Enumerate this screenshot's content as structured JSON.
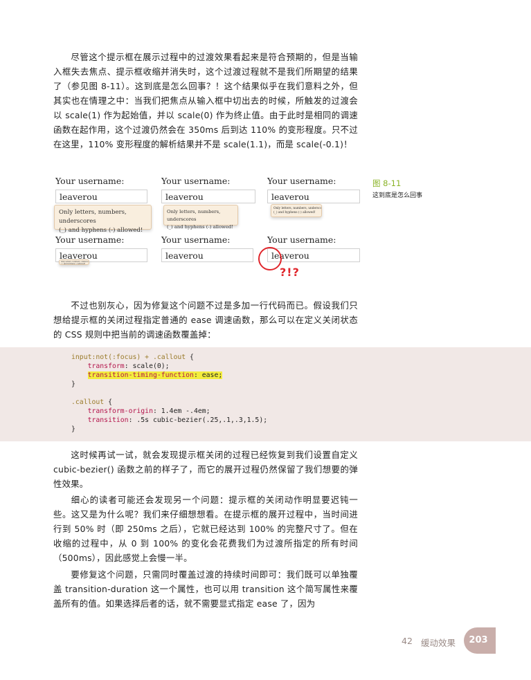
{
  "paragraphs": {
    "p1": "尽管这个提示框在展示过程中的过渡效果看起来是符合预期的，但是当输入框失去焦点、提示框收缩并消失时，这个过渡过程就不是我们所期望的结果了（参见图 8-11）。这到底是怎么回事？！这个结果似乎在我们意料之外，但其实也在情理之中：当我们把焦点从输入框中切出去的时候，所触发的过渡会以 scale(1) 作为起始值，并以 scale(0) 作为终止值。由于此时是相同的调速函数在起作用，这个过渡仍然会在 350ms 后到达 110% 的变形程度。只不过在这里，110% 变形程度的解析结果并不是 scale(1.1)，而是 scale(-0.1)！",
    "p2": "不过也别灰心，因为修复这个问题不过是多加一行代码而已。假设我们只想给提示框的关闭过程指定普通的 ease 调速函数，那么可以在定义关闭状态的 CSS 规则中把当前的调速函数覆盖掉：",
    "p3": "这时候再试一试，就会发现提示框关闭的过程已经恢复到我们设置自定义 cubic-bezier() 函数之前的样子了，而它的展开过程仍然保留了我们想要的弹性效果。",
    "p4": "细心的读者可能还会发现另一个问题：提示框的关闭动作明显要迟钝一些。这又是为什么呢？我们来仔细想想看。在提示框的展开过程中，当时间进行到 50% 时（即 250ms 之后），它就已经达到 100% 的完整尺寸了。但在收缩的过程中，从 0 到 100% 的变化会花费我们为过渡所指定的所有时间（500ms），因此感觉上会慢一半。",
    "p5": "要修复这个问题，只需同时覆盖过渡的持续时间即可：我们既可以单独覆盖 transition-duration 这一个属性，也可以用 transition 这个简写属性来覆盖所有的值。如果选择后者的话，就不需要显式指定 ease 了，因为"
  },
  "figure": {
    "number": "图 8-11",
    "caption": "这到底是怎么回事",
    "label": "Your username:",
    "value": "leaverou",
    "callout_line1": "Only letters, numbers, underscores",
    "callout_line2": "(_) and hyphens (-) allowed!",
    "exclaim": "?!?"
  },
  "code": {
    "l1_sel": "input:not(:focus) + .callout",
    "l1_brace": " {",
    "l2_prop": "transform",
    "l2_val": ": scale(0);",
    "l3_prop": "transition-timing-function",
    "l3_val": ": ease;",
    "l4": "}",
    "l5_sel": ".callout",
    "l5_brace": " {",
    "l6_prop": "transform-origin",
    "l6_val": ": 1.4em -.4em;",
    "l7_prop": "transition",
    "l7_val": ": .5s cubic-bezier(.25,.1,.3,1.5);",
    "l8": "}"
  },
  "footer": {
    "chapter_num": "42",
    "chapter_title": "缓动效果",
    "page": "203"
  },
  "colors": {
    "accent": "#8ab326",
    "alert": "#e0262c",
    "code_bg": "#f1e8e6",
    "badge": "#c9aeaa"
  }
}
